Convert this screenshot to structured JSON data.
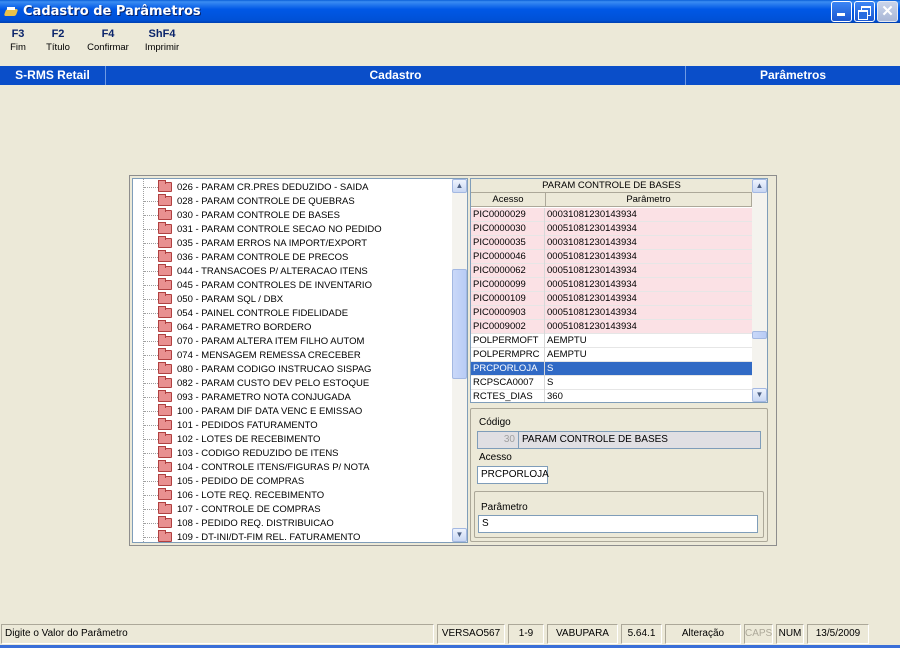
{
  "window": {
    "title": "Cadastro de Parâmetros"
  },
  "fkeys": [
    {
      "key": "F3",
      "label": "Fim"
    },
    {
      "key": "F2",
      "label": "Título"
    },
    {
      "key": "F4",
      "label": "Confirmar"
    },
    {
      "key": "ShF4",
      "label": "Imprimir"
    }
  ],
  "header": {
    "left": "S-RMS Retail",
    "center": "Cadastro",
    "right": "Parâmetros"
  },
  "tree": {
    "items": [
      "026 - PARAM CR.PRES DEDUZIDO - SAIDA",
      "028 - PARAM CONTROLE DE QUEBRAS",
      "030 - PARAM CONTROLE DE BASES",
      "031 - PARAM CONTROLE SECAO NO PEDIDO",
      "035 - PARAM ERROS NA IMPORT/EXPORT",
      "036 - PARAM CONTROLE DE PRECOS",
      "044 - TRANSACOES P/ ALTERACAO ITENS",
      "045 - PARAM CONTROLES DE INVENTARIO",
      "050 - PARAM SQL / DBX",
      "054 - PAINEL CONTROLE FIDELIDADE",
      "064 - PARAMETRO BORDERO",
      "070 - PARAM ALTERA ITEM FILHO AUTOM",
      "074 - MENSAGEM REMESSA CRECEBER",
      "080 - PARAM CODIGO INSTRUCAO SISPAG",
      "082 - PARAM CUSTO DEV PELO ESTOQUE",
      "093 - PARAMETRO NOTA CONJUGADA",
      "100 - PARAM DIF DATA VENC E EMISSAO",
      "101 - PEDIDOS FATURAMENTO",
      "102 - LOTES DE RECEBIMENTO",
      "103 - CODIGO REDUZIDO DE ITENS",
      "104 - CONTROLE ITENS/FIGURAS P/ NOTA",
      "105 - PEDIDO DE COMPRAS",
      "106 - LOTE REQ. RECEBIMENTO",
      "107 - CONTROLE DE COMPRAS",
      "108 - PEDIDO REQ. DISTRIBUICAO",
      "109 - DT-INI/DT-FIM REL. FATURAMENTO"
    ]
  },
  "grid": {
    "title": "PARAM CONTROLE DE BASES",
    "columns": [
      "Acesso",
      "Parâmetro"
    ],
    "rows": [
      {
        "acesso": "PIC0000029",
        "parametro": "00031081230143934",
        "style": "pink"
      },
      {
        "acesso": "PIC0000030",
        "parametro": "00051081230143934",
        "style": "pink"
      },
      {
        "acesso": "PIC0000035",
        "parametro": "00031081230143934",
        "style": "pink"
      },
      {
        "acesso": "PIC0000046",
        "parametro": "00051081230143934",
        "style": "pink"
      },
      {
        "acesso": "PIC0000062",
        "parametro": "00051081230143934",
        "style": "pink"
      },
      {
        "acesso": "PIC0000099",
        "parametro": "00051081230143934",
        "style": "pink"
      },
      {
        "acesso": "PIC0000109",
        "parametro": "00051081230143934",
        "style": "pink"
      },
      {
        "acesso": "PIC0000903",
        "parametro": "00051081230143934",
        "style": "pink"
      },
      {
        "acesso": "PIC0009002",
        "parametro": "00051081230143934",
        "style": "pink"
      },
      {
        "acesso": "POLPERMOFT",
        "parametro": "AEMPTU",
        "style": ""
      },
      {
        "acesso": "POLPERMPRC",
        "parametro": "AEMPTU",
        "style": ""
      },
      {
        "acesso": "PRCPORLOJA",
        "parametro": "S",
        "style": "sel"
      },
      {
        "acesso": "RCPSCA0007",
        "parametro": "S",
        "style": ""
      },
      {
        "acesso": "RCTES_DIAS",
        "parametro": "360",
        "style": ""
      }
    ]
  },
  "detail": {
    "codigo_label": "Código",
    "codigo_value": "30",
    "codigo_desc": "PARAM CONTROLE DE BASES",
    "acesso_label": "Acesso",
    "acesso_value": "PRCPORLOJA",
    "parametro_label": "Parâmetro",
    "parametro_value": "S"
  },
  "status": {
    "message": "Digite o Valor do Parâmetro",
    "version": "VERSAO567",
    "page": "1-9",
    "company": "VABUPARA",
    "build": "5.64.1",
    "mode": "Alteração",
    "caps": "CAPS",
    "num": "NUM",
    "date": "13/5/2009"
  }
}
